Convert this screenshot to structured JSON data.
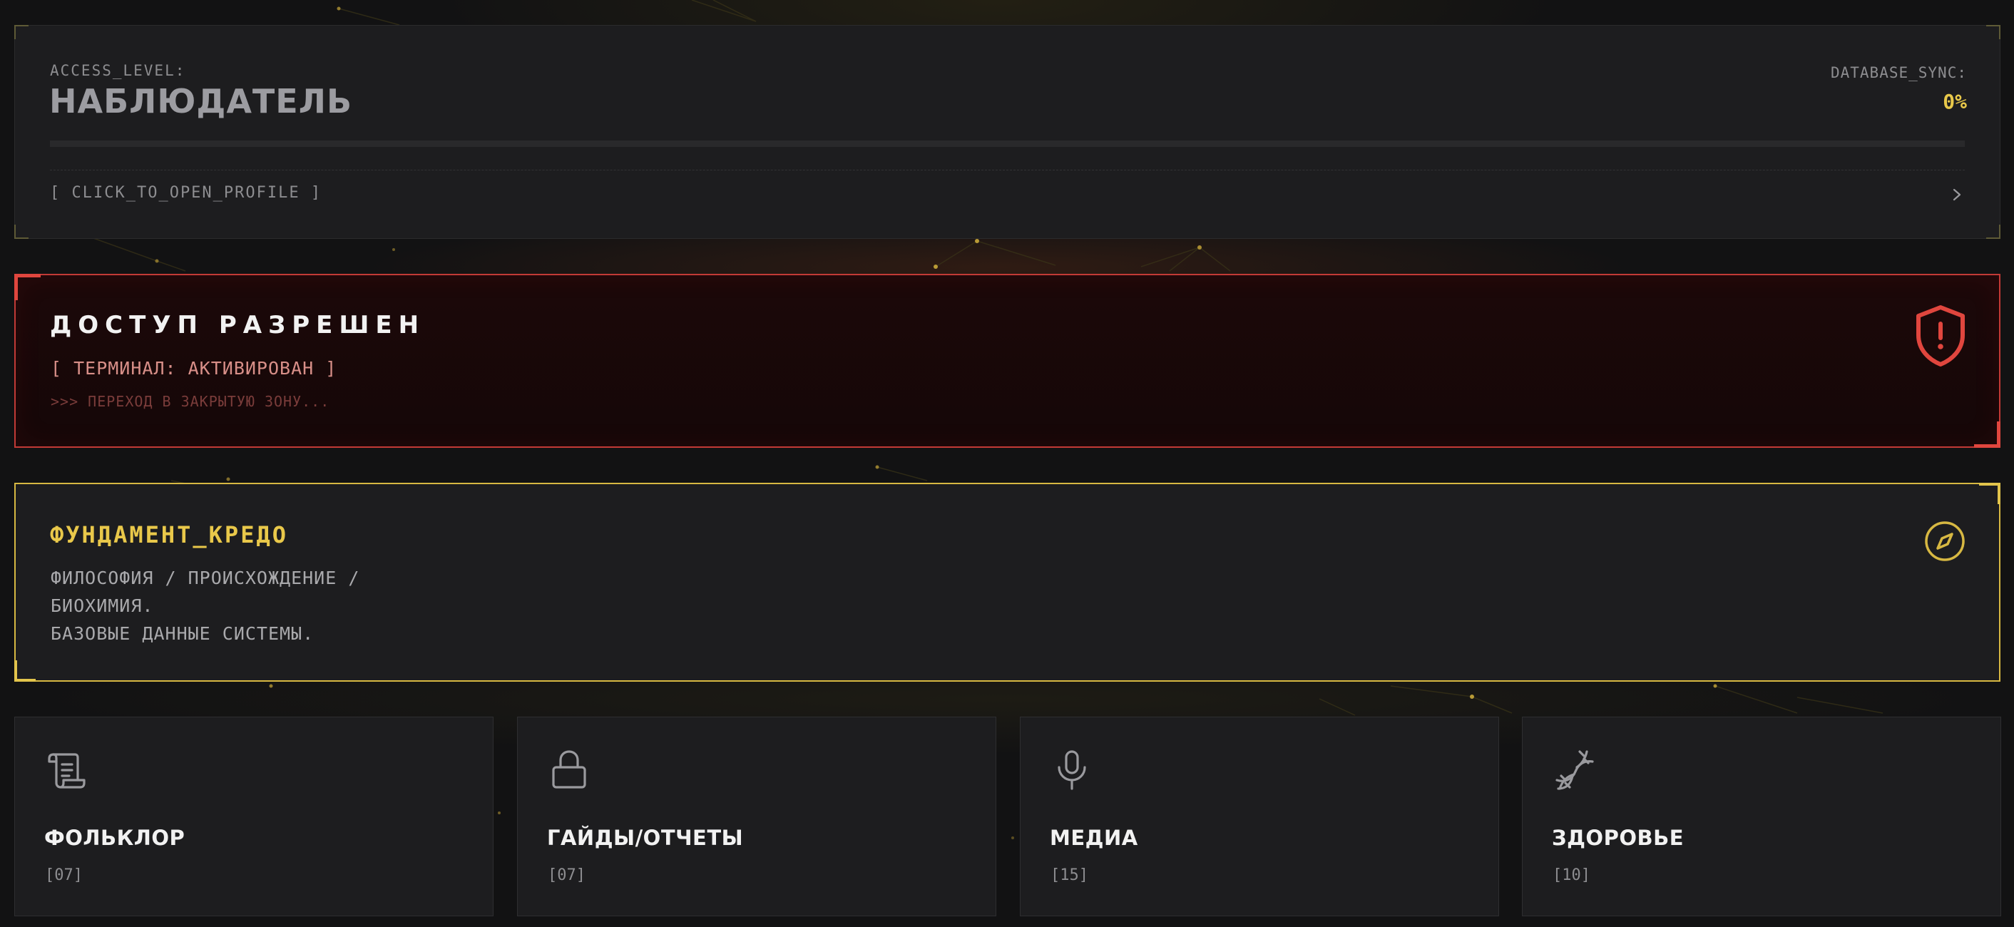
{
  "profile": {
    "access_label": "ACCESS_LEVEL:",
    "access_value": "НАБЛЮДАТЕЛЬ",
    "sync_label": "DATABASE_SYNC:",
    "sync_value": "0%",
    "sync_progress": 0,
    "cta": "[ CLICK_TO_OPEN_PROFILE ]",
    "cta_icon": "chevron-right-icon"
  },
  "access": {
    "title": "ДОСТУП РАЗРЕШЕН",
    "subtitle": "[ ТЕРМИНАЛ: АКТИВИРОВАН ]",
    "hint": ">>> ПЕРЕХОД В ЗАКРЫТУЮ ЗОНУ...",
    "icon": "shield-alert-icon"
  },
  "credo": {
    "title": "ФУНДАМЕНТ_КРЕДО",
    "lines": [
      "ФИЛОСОФИЯ / ПРОИСХОЖДЕНИЕ /",
      "БИОХИМИЯ.",
      "БАЗОВЫЕ ДАННЫЕ СИСТЕМЫ."
    ],
    "icon": "compass-icon"
  },
  "categories": [
    {
      "title": "ФОЛЬКЛОР",
      "count": "[07]",
      "icon": "scroll-icon"
    },
    {
      "title": "ГАЙДЫ/ОТЧЕТЫ",
      "count": "[07]",
      "icon": "lock-icon"
    },
    {
      "title": "МЕДИА",
      "count": "[15]",
      "icon": "microphone-icon"
    },
    {
      "title": "ЗДОРОВЬЕ",
      "count": "[10]",
      "icon": "dna-icon"
    }
  ],
  "colors": {
    "background": "#121213",
    "panel": "#1d1d1f",
    "accent_yellow": "#e8c84a",
    "accent_red": "#c23a36",
    "text_primary": "#f2f2f2",
    "text_muted": "#8d8d90"
  }
}
